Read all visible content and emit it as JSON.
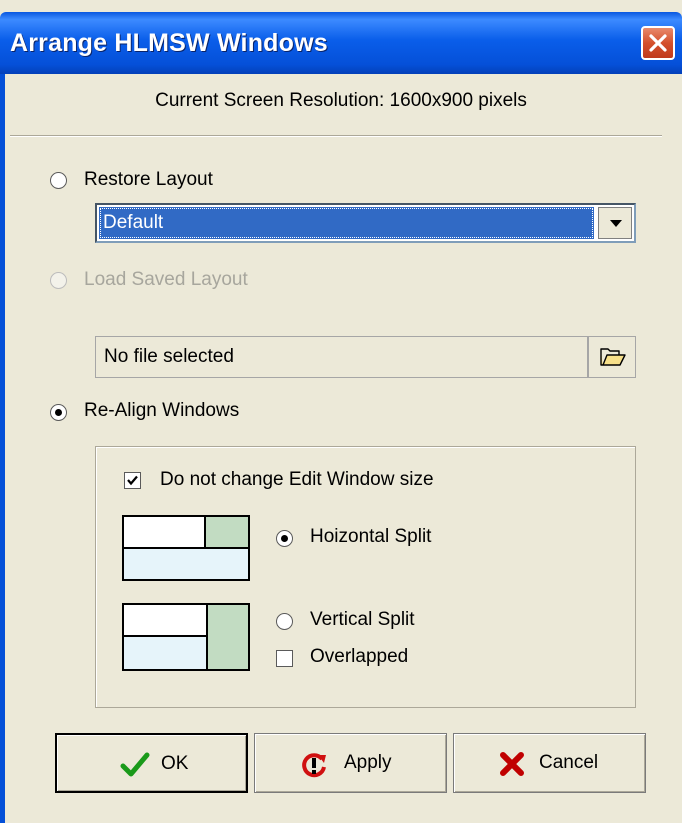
{
  "window": {
    "title": "Arrange HLMSW Windows",
    "close_icon": "close-icon",
    "titlebar_color": "#0a5eea"
  },
  "resolution_text": "Current Screen Resolution: 1600x900 pixels",
  "restore_layout": {
    "label": "Restore Layout",
    "selected": false,
    "dropdown_value": "Default"
  },
  "load_saved_layout": {
    "label": "Load Saved Layout",
    "enabled": false,
    "selected": false,
    "file_text": "No file selected",
    "browse_icon": "folder-open-icon"
  },
  "realign": {
    "label": "Re-Align Windows",
    "selected": true,
    "keep_size": {
      "label": "Do not change Edit Window size",
      "checked": true
    },
    "horizontal": {
      "label": "Hoizontal Split",
      "selected": true,
      "icon": "horizontal-split-layout-icon"
    },
    "vertical": {
      "label": "Vertical Split",
      "selected": false,
      "icon": "vertical-split-layout-icon"
    },
    "overlapped": {
      "label": "Overlapped",
      "checked": false
    }
  },
  "buttons": {
    "ok": {
      "label": "OK",
      "icon": "checkmark-icon"
    },
    "apply": {
      "label": "Apply",
      "icon": "apply-icon"
    },
    "cancel": {
      "label": "Cancel",
      "icon": "x-mark-icon"
    }
  },
  "colors": {
    "dialog_bg": "#ece9d8",
    "selection": "#316ac5",
    "layout_green": "#c2dcc2",
    "layout_blue": "#e6f4fa"
  }
}
